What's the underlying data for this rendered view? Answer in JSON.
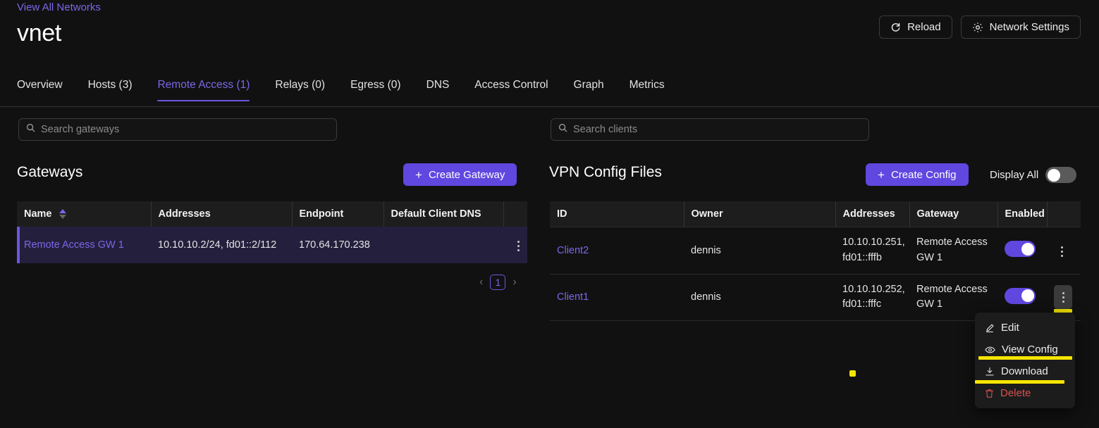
{
  "header": {
    "breadcrumb": "View All Networks",
    "title": "vnet",
    "reload_label": "Reload",
    "network_settings_label": "Network Settings"
  },
  "tabs": [
    {
      "label": "Overview",
      "active": false
    },
    {
      "label": "Hosts (3)",
      "active": false
    },
    {
      "label": "Remote Access (1)",
      "active": true
    },
    {
      "label": "Relays (0)",
      "active": false
    },
    {
      "label": "Egress (0)",
      "active": false
    },
    {
      "label": "DNS",
      "active": false
    },
    {
      "label": "Access Control",
      "active": false
    },
    {
      "label": "Graph",
      "active": false
    },
    {
      "label": "Metrics",
      "active": false
    }
  ],
  "gateways": {
    "search_placeholder": "Search gateways",
    "search_value": "",
    "section_title": "Gateways",
    "create_label": "Create Gateway",
    "columns": [
      "Name",
      "Addresses",
      "Endpoint",
      "Default Client DNS"
    ],
    "rows": [
      {
        "name": "Remote Access GW 1",
        "addresses": "10.10.10.2/24, fd01::2/112",
        "endpoint": "170.64.170.238",
        "default_client_dns": "",
        "selected": true
      }
    ],
    "pagination": {
      "prev": "‹",
      "page": "1",
      "next": "›"
    }
  },
  "vpn": {
    "search_placeholder": "Search clients",
    "search_value": "",
    "section_title": "VPN Config Files",
    "create_label": "Create Config",
    "display_all_label": "Display All",
    "display_all_on": false,
    "columns": [
      "ID",
      "Owner",
      "Addresses",
      "Gateway",
      "Enabled"
    ],
    "rows": [
      {
        "id": "Client2",
        "owner": "dennis",
        "addresses": "10.10.10.251, fd01::fffb",
        "gateway": "Remote Access GW 1",
        "enabled": true,
        "menu_open": false
      },
      {
        "id": "Client1",
        "owner": "dennis",
        "addresses": "10.10.10.252, fd01::fffc",
        "gateway": "Remote Access GW 1",
        "enabled": true,
        "menu_open": true
      }
    ]
  },
  "context_menu": {
    "items": [
      {
        "label": "Edit",
        "icon": "pencil-icon",
        "danger": false
      },
      {
        "label": "View Config",
        "icon": "eye-icon",
        "danger": false
      },
      {
        "label": "Download",
        "icon": "download-icon",
        "danger": false
      },
      {
        "label": "Delete",
        "icon": "trash-icon",
        "danger": true
      }
    ]
  },
  "colors": {
    "background": "#111111",
    "accent": "#6047e0",
    "link": "#7a68e8",
    "highlight": "#f5e400",
    "danger": "#d9534f",
    "selected_row": "#241f3d"
  }
}
